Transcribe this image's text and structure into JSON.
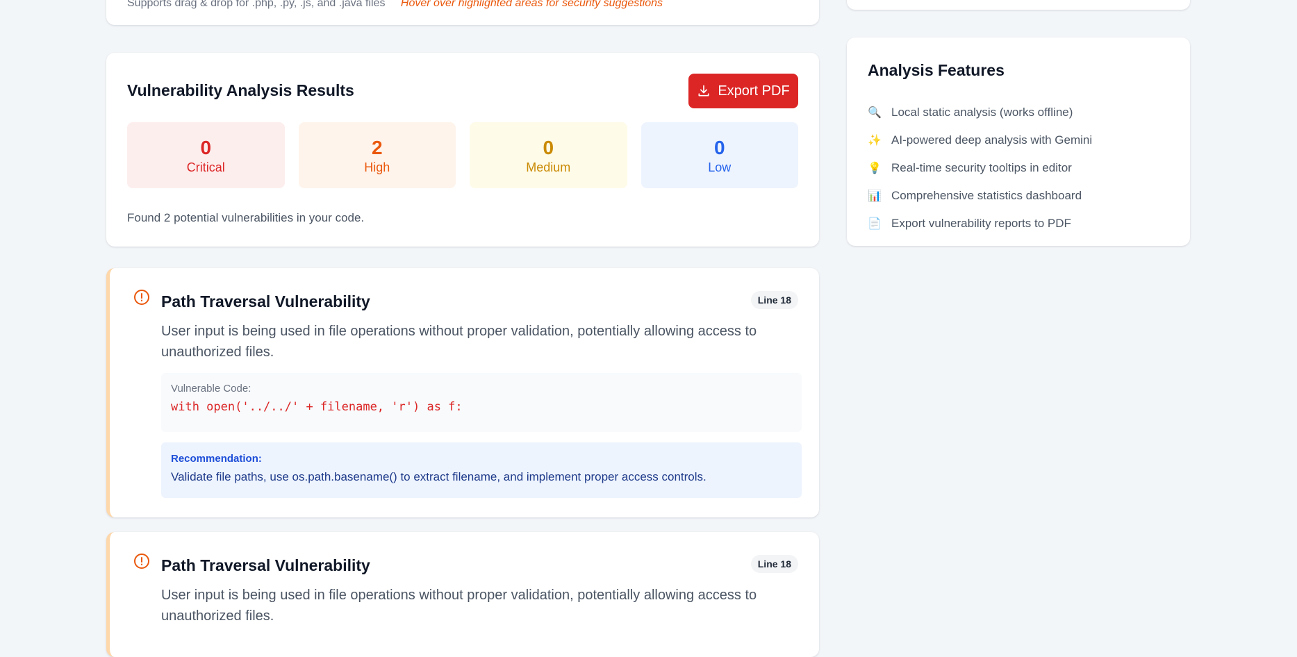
{
  "upload": {
    "hint": "Supports drag & drop for .php, .py, .js, and .java files",
    "accent_hint": "Hover over highlighted areas for security suggestions"
  },
  "results": {
    "title": "Vulnerability Analysis Results",
    "export_label": "Export PDF",
    "stats": [
      {
        "value": "0",
        "label": "Critical"
      },
      {
        "value": "2",
        "label": "High"
      },
      {
        "value": "0",
        "label": "Medium"
      },
      {
        "value": "0",
        "label": "Low"
      }
    ],
    "found_text": "Found 2 potential vulnerabilities in your code."
  },
  "vulnerabilities": [
    {
      "title": "Path Traversal Vulnerability",
      "line": "Line 18",
      "description": "User input is being used in file operations without proper validation, potentially allowing access to unauthorized files.",
      "code_label": "Vulnerable Code:",
      "code": "with open('../../' + filename, 'r') as f:",
      "rec_label": "Recommendation:",
      "recommendation": "Validate file paths, use os.path.basename() to extract filename, and implement proper access controls."
    },
    {
      "title": "Path Traversal Vulnerability",
      "line": "Line 18",
      "description": "User input is being used in file operations without proper validation, potentially allowing access to unauthorized files."
    }
  ],
  "features": {
    "title": "Analysis Features",
    "items": [
      {
        "icon": "🔍",
        "label": "Local static analysis (works offline)"
      },
      {
        "icon": "✨",
        "label": "AI-powered deep analysis with Gemini"
      },
      {
        "icon": "💡",
        "label": "Real-time security tooltips in editor"
      },
      {
        "icon": "📊",
        "label": "Comprehensive statistics dashboard"
      },
      {
        "icon": "📄",
        "label": "Export vulnerability reports to PDF"
      }
    ]
  },
  "colors": {
    "critical": "#dc2626",
    "high": "#ea580c",
    "medium": "#ca8a04",
    "low": "#2563eb",
    "export_button": "#dc2626"
  }
}
